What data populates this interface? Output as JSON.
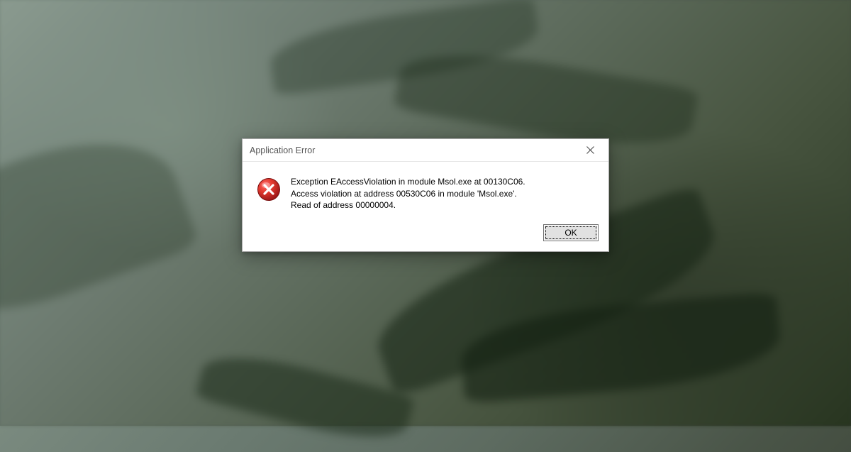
{
  "dialog": {
    "title": "Application Error",
    "message_line1": "Exception EAccessViolation in module Msol.exe at 00130C06.",
    "message_line2": "Access violation at address 00530C06 in module 'Msol.exe'.",
    "message_line3": "Read of address 00000004.",
    "ok_label": "OK"
  }
}
